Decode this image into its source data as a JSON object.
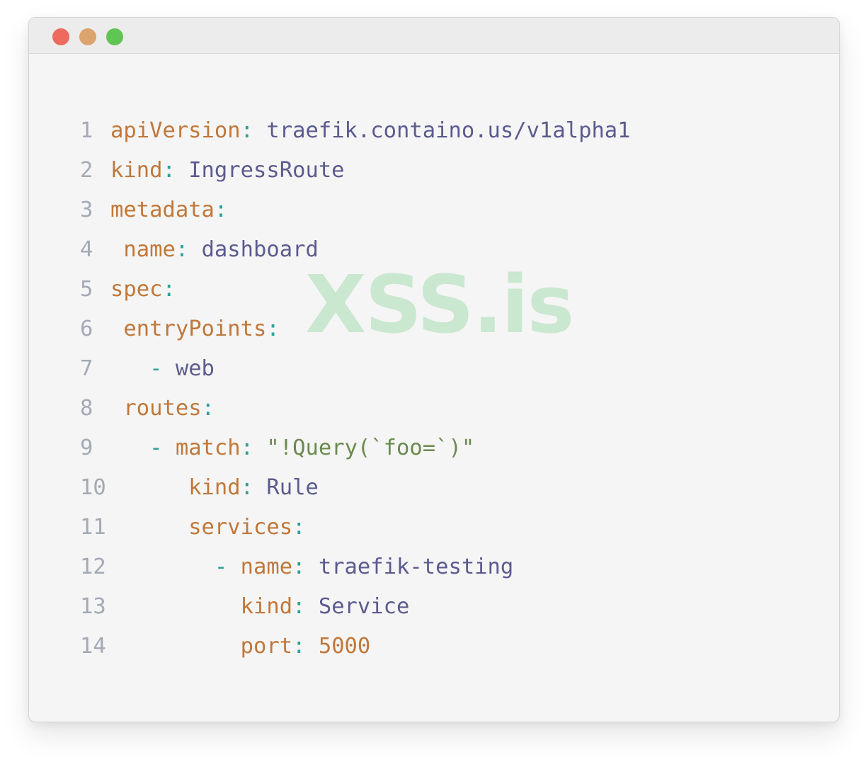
{
  "colors": {
    "key": "#c0783a",
    "punct": "#2aa198",
    "value": "#5b5b8f",
    "string": "#6a8a4e",
    "number": "#c0783a",
    "line_number": "#a3aab5",
    "dot_red": "#ed6a5e",
    "dot_yellow": "#dba36d",
    "dot_green": "#61c554",
    "watermark": "rgba(150, 215, 165, 0.45)"
  },
  "window_controls": [
    "close-icon",
    "minimize-icon",
    "maximize-icon"
  ],
  "watermark": "XSS.is",
  "code_lines": [
    {
      "n": "1",
      "tokens": [
        {
          "t": "key",
          "v": "apiVersion"
        },
        {
          "t": "punct",
          "v": ": "
        },
        {
          "t": "value",
          "v": "traefik.containo.us/v1alpha1"
        }
      ]
    },
    {
      "n": "2",
      "tokens": [
        {
          "t": "key",
          "v": "kind"
        },
        {
          "t": "punct",
          "v": ": "
        },
        {
          "t": "value",
          "v": "IngressRoute"
        }
      ]
    },
    {
      "n": "3",
      "tokens": [
        {
          "t": "key",
          "v": "metadata"
        },
        {
          "t": "punct",
          "v": ":"
        }
      ]
    },
    {
      "n": "4",
      "tokens": [
        {
          "t": "plain",
          "v": " "
        },
        {
          "t": "key",
          "v": "name"
        },
        {
          "t": "punct",
          "v": ": "
        },
        {
          "t": "value",
          "v": "dashboard"
        }
      ]
    },
    {
      "n": "5",
      "tokens": [
        {
          "t": "key",
          "v": "spec"
        },
        {
          "t": "punct",
          "v": ":"
        }
      ]
    },
    {
      "n": "6",
      "tokens": [
        {
          "t": "plain",
          "v": " "
        },
        {
          "t": "key",
          "v": "entryPoints"
        },
        {
          "t": "punct",
          "v": ":"
        }
      ]
    },
    {
      "n": "7",
      "tokens": [
        {
          "t": "plain",
          "v": "   "
        },
        {
          "t": "punct",
          "v": "- "
        },
        {
          "t": "value",
          "v": "web"
        }
      ]
    },
    {
      "n": "8",
      "tokens": [
        {
          "t": "plain",
          "v": " "
        },
        {
          "t": "key",
          "v": "routes"
        },
        {
          "t": "punct",
          "v": ":"
        }
      ]
    },
    {
      "n": "9",
      "tokens": [
        {
          "t": "plain",
          "v": "   "
        },
        {
          "t": "punct",
          "v": "- "
        },
        {
          "t": "key",
          "v": "match"
        },
        {
          "t": "punct",
          "v": ": "
        },
        {
          "t": "string",
          "v": "\"!Query(`foo=`)\""
        }
      ]
    },
    {
      "n": "10",
      "tokens": [
        {
          "t": "plain",
          "v": "      "
        },
        {
          "t": "key",
          "v": "kind"
        },
        {
          "t": "punct",
          "v": ": "
        },
        {
          "t": "value",
          "v": "Rule"
        }
      ]
    },
    {
      "n": "11",
      "tokens": [
        {
          "t": "plain",
          "v": "      "
        },
        {
          "t": "key",
          "v": "services"
        },
        {
          "t": "punct",
          "v": ":"
        }
      ]
    },
    {
      "n": "12",
      "tokens": [
        {
          "t": "plain",
          "v": "        "
        },
        {
          "t": "punct",
          "v": "- "
        },
        {
          "t": "key",
          "v": "name"
        },
        {
          "t": "punct",
          "v": ": "
        },
        {
          "t": "value",
          "v": "traefik-testing"
        }
      ]
    },
    {
      "n": "13",
      "tokens": [
        {
          "t": "plain",
          "v": "          "
        },
        {
          "t": "key",
          "v": "kind"
        },
        {
          "t": "punct",
          "v": ": "
        },
        {
          "t": "value",
          "v": "Service"
        }
      ]
    },
    {
      "n": "14",
      "tokens": [
        {
          "t": "plain",
          "v": "          "
        },
        {
          "t": "key",
          "v": "port"
        },
        {
          "t": "punct",
          "v": ": "
        },
        {
          "t": "number",
          "v": "5000"
        }
      ]
    }
  ]
}
